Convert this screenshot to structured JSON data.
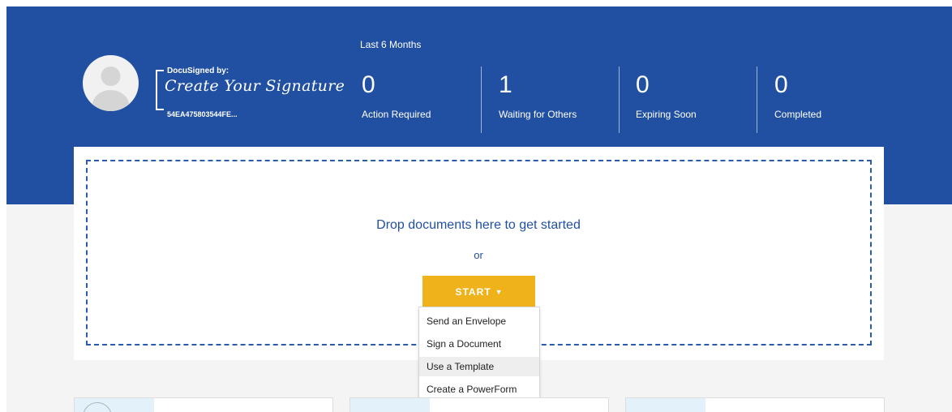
{
  "profile": {
    "signature": {
      "signed_by": "DocuSigned by:",
      "text": "Create Your Signature",
      "id": "54EA475803544FE..."
    }
  },
  "overview": {
    "period": "Last 6 Months",
    "stats": [
      {
        "count": "0",
        "label": "Action Required"
      },
      {
        "count": "1",
        "label": "Waiting for Others"
      },
      {
        "count": "0",
        "label": "Expiring Soon"
      },
      {
        "count": "0",
        "label": "Completed"
      }
    ]
  },
  "drop_area": {
    "prompt": "Drop documents here to get started",
    "or": "or"
  },
  "start": {
    "label": "START",
    "caret": "▼",
    "menu": [
      {
        "label": "Send an Envelope"
      },
      {
        "label": "Sign a Document"
      },
      {
        "label": "Use a Template"
      },
      {
        "label": "Create a PowerForm"
      }
    ],
    "highlighted_item": "Use a Template"
  },
  "colors": {
    "header": "#2150a3",
    "accent": "#f0b21a",
    "link_text": "#2150a3"
  }
}
